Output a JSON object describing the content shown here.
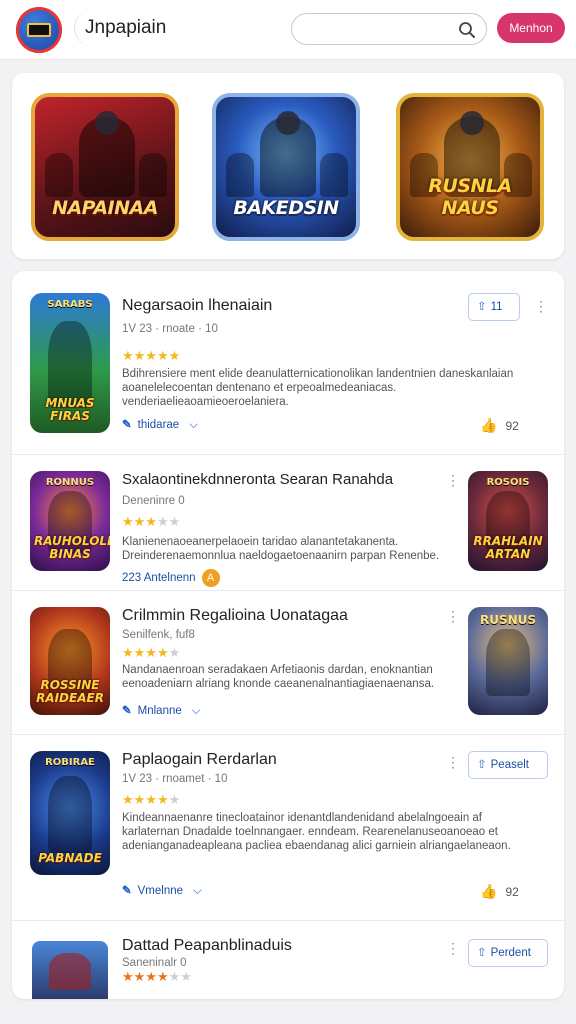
{
  "header": {
    "app_title": "Jnpapiain",
    "search": {
      "placeholder": "",
      "value": ""
    },
    "member_button": "Menhon"
  },
  "featured": [
    {
      "label": "NAPAINAA"
    },
    {
      "label": "BAKEDSIN"
    },
    {
      "label": "RUSNLA NAUS"
    }
  ],
  "items": [
    {
      "icon_top": "SARABS",
      "icon_tag": "MNUAS FIRAS",
      "title": "Negarsaoin lhenaiain",
      "meta": "1V 23 · rnoate · 10",
      "stars": "★★★★★",
      "stars_off": "",
      "desc": "Bdihrensiere ment elide deanulatternicationolikan landentnien daneskanlaian aoanelelecoentan dentenano et erpeoalmedeaniacas. venderiaelieaoamieoeroelaniera.",
      "author": "thidarae",
      "likes": "92",
      "action": "11"
    },
    {
      "icon_top": "RONNUS",
      "icon_tag": "RAUHOLOLE BINAS",
      "right_top": "ROSOIS",
      "right_tag": "RRAHLAIN ARTAN",
      "title": "Sxalaontinekdnneronta Searan Ranahda",
      "meta": "Deneninre 0",
      "stars": "★★★",
      "stars_off": "★★",
      "desc": "Klanienenaoeanerpelaoein taridao alanantetakanenta. Dreinderenaemonnlua naeldogaetoenaanirn parpan Renenbe.",
      "author": "223 Antelnenn",
      "badge": "A"
    },
    {
      "icon_tag": "ROSSINE RAIDEAER",
      "right_top": "RUSNUS",
      "title": "Crilmmin Regalioina Uonatagaa",
      "meta": "Senilfenk, fuf8",
      "stars": "★★★★",
      "stars_off": "★",
      "desc": "Nandanaenroan seradakaen Arfetiaonis dardan, enoknantian eenoadeniarn alriang knonde caeanenalnantiagiaenaenansa.",
      "author": "Mnlanne"
    },
    {
      "icon_top": "ROBIRAE",
      "icon_tag": "PABNADE",
      "title": "Paplaogain Rerdarlan",
      "meta": "1V 23 · rnoamet · 10",
      "stars": "★★★★",
      "stars_off": "★",
      "desc": "Kindeannaenanre tinecloatainor idenantdlandenidand abelalngoeain af karlaternan Dnadalde toelnnangaer. enndeam. Rearenelanuseoanoeao et adenianganadeapleana pacliea ebaendanag alici garniein alriangaelaneaon.",
      "author": "Vmelnne",
      "likes": "92",
      "action": "Peaselt"
    },
    {
      "title": "Dattad Peapanblinaduis",
      "meta": "Saneninalr 0",
      "stars": "★★★★",
      "stars_off": "★★",
      "action": "Perdent"
    }
  ]
}
